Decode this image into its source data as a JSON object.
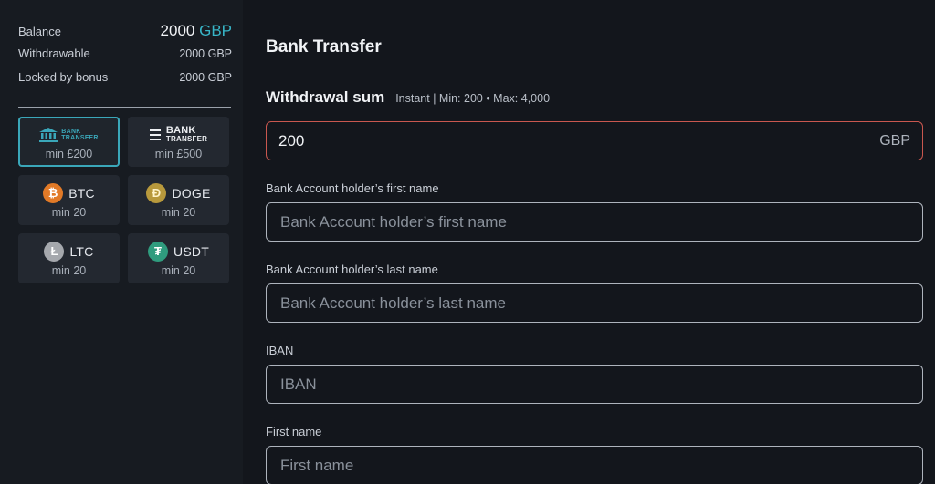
{
  "sidebar": {
    "balance": {
      "label": "Balance",
      "amount": "2000",
      "currency": "GBP"
    },
    "withdrawable": {
      "label": "Withdrawable",
      "value": "2000 GBP"
    },
    "locked": {
      "label": "Locked by bonus",
      "value": "2000 GBP"
    },
    "methods": [
      {
        "id": "bank-transfer-1",
        "logo_line1": "BANK",
        "logo_line2": "TRANSFER",
        "min": "min £200",
        "active": true
      },
      {
        "id": "bank-transfer-2",
        "logo_line1": "BANK",
        "logo_line2": "TRANSFER",
        "min": "min £500",
        "active": false
      },
      {
        "id": "btc",
        "name": "BTC",
        "symbol": "₿",
        "min": "min 20"
      },
      {
        "id": "doge",
        "name": "DOGE",
        "symbol": "Đ",
        "min": "min 20"
      },
      {
        "id": "ltc",
        "name": "LTC",
        "symbol": "Ł",
        "min": "min 20"
      },
      {
        "id": "usdt",
        "name": "USDT",
        "symbol": "₮",
        "min": "min 20"
      }
    ]
  },
  "main": {
    "title": "Bank Transfer",
    "sum": {
      "label": "Withdrawal sum",
      "note": "Instant | Min: 200 • Max: 4,000",
      "value": "200",
      "currency": "GBP"
    },
    "fields": [
      {
        "label": "Bank Account holder’s first name",
        "placeholder": "Bank Account holder’s first name"
      },
      {
        "label": "Bank Account holder’s last name",
        "placeholder": "Bank Account holder’s last name"
      },
      {
        "label": "IBAN",
        "placeholder": "IBAN"
      },
      {
        "label": "First name",
        "placeholder": "First name"
      }
    ]
  },
  "colors": {
    "accent": "#38b6c8",
    "error_border": "#c9574f",
    "btc": "#e27a27",
    "doge": "#b8993c",
    "ltc": "#a5a8ad",
    "usdt": "#2f9c7e"
  },
  "icons": {
    "bank": "bank-building-icon",
    "btc": "bitcoin-icon",
    "doge": "dogecoin-icon",
    "ltc": "litecoin-icon",
    "usdt": "tether-icon"
  }
}
